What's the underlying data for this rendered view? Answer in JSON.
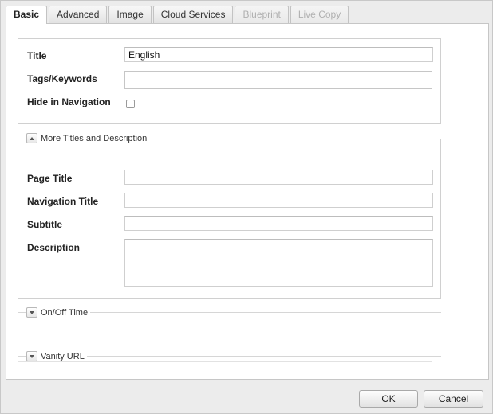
{
  "tabs": [
    {
      "label": "Basic",
      "state": "active"
    },
    {
      "label": "Advanced",
      "state": "normal"
    },
    {
      "label": "Image",
      "state": "normal"
    },
    {
      "label": "Cloud Services",
      "state": "normal"
    },
    {
      "label": "Blueprint",
      "state": "disabled"
    },
    {
      "label": "Live Copy",
      "state": "disabled"
    }
  ],
  "basic": {
    "title_label": "Title",
    "title_value": "English",
    "tags_label": "Tags/Keywords",
    "tags_value": "",
    "hide_label": "Hide in Navigation",
    "hide_checked": false
  },
  "more_titles": {
    "legend": "More Titles and Description",
    "page_title_label": "Page Title",
    "page_title_value": "",
    "nav_title_label": "Navigation Title",
    "nav_title_value": "",
    "subtitle_label": "Subtitle",
    "subtitle_value": "",
    "description_label": "Description",
    "description_value": ""
  },
  "onoff": {
    "legend": "On/Off Time"
  },
  "vanity": {
    "legend": "Vanity URL"
  },
  "footer": {
    "ok_label": "OK",
    "cancel_label": "Cancel"
  }
}
